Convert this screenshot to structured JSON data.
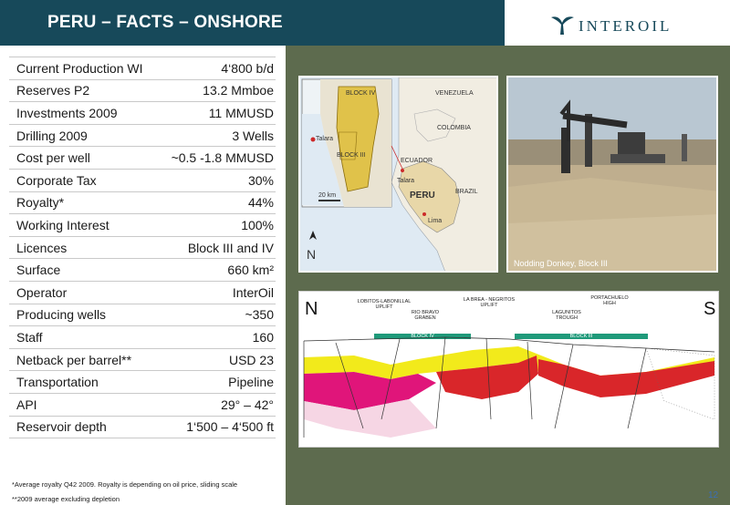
{
  "header": {
    "title": "PERU – FACTS – ONSHORE"
  },
  "logo": {
    "text": "INTEROIL"
  },
  "facts": [
    {
      "label": "Current Production WI",
      "value": "4‘800 b/d"
    },
    {
      "label": "Reserves P2",
      "value": "13.2 Mmboe"
    },
    {
      "label": "Investments 2009",
      "value": "11 MMUSD"
    },
    {
      "label": "Drilling 2009",
      "value": "3 Wells"
    },
    {
      "label": "Cost per well",
      "value": "~0.5 -1.8 MMUSD"
    },
    {
      "label": "Corporate Tax",
      "value": "30%"
    },
    {
      "label": "Royalty*",
      "value": "44%"
    },
    {
      "label": "Working Interest",
      "value": "100%"
    },
    {
      "label": "Licences",
      "value": "Block III and IV"
    },
    {
      "label": "Surface",
      "value": "660 km²"
    },
    {
      "label": "Operator",
      "value": "InterOil"
    },
    {
      "label": "Producing wells",
      "value": "~350"
    },
    {
      "label": "Staff",
      "value": "160"
    },
    {
      "label": "Netback per barrel**",
      "value": "USD 23"
    },
    {
      "label": "Transportation",
      "value": "Pipeline"
    },
    {
      "label": "API",
      "value": "29° – 42°"
    },
    {
      "label": "Reservoir depth",
      "value": "1‘500 – 4‘500 ft"
    }
  ],
  "footnotes": {
    "royalty": "*Average royalty Q42 2009. Royalty is depending on oil price, sliding scale",
    "netback": "**2009 average excluding depletion"
  },
  "map": {
    "labels": {
      "block_iv": "BLOCK IV",
      "block_iii": "BLOCK III",
      "talara_inset": "Talara",
      "scale": "20 km",
      "venezuela": "VENEZUELA",
      "colombia": "COLOMBIA",
      "ecuador": "ECUADOR",
      "brazil": "BRAZIL",
      "peru": "PERU",
      "talara": "Talara",
      "lima": "Lima",
      "north": "N"
    }
  },
  "photo": {
    "caption": "Nodding Donkey, Block III"
  },
  "section": {
    "north": "N",
    "south": "S",
    "labels": {
      "lobitos": "LOBITOS-LABONILLAL UPLIFT",
      "labrea": "LA BREA - NEGRITOS UPLIFT",
      "portachuelo": "PORTACHUELO HIGH",
      "rio_bravo": "RIO BRAVO GRABEN",
      "lagunitos": "LAGUNITOS TROUGH",
      "block_iv": "BLOCK IV",
      "block_iii": "BLOCK III"
    }
  },
  "page_number": "12",
  "colors": {
    "header_bg": "#17495a",
    "right_bg": "#5d6b4e",
    "page_number": "#3b6fb6"
  }
}
